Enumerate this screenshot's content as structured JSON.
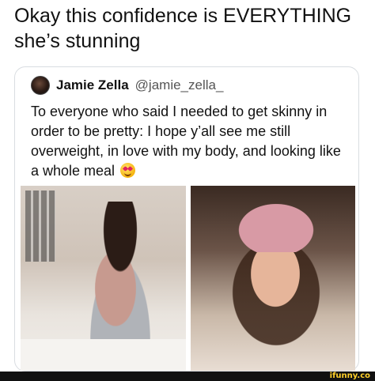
{
  "caption": {
    "line1": "Okay this confidence is EVERYTHING",
    "line2": "she’s stunning"
  },
  "tweet": {
    "author_name": "Jamie Zella",
    "author_handle": "@jamie_zella_",
    "text": "To everyone who said I needed to get skinny in order to be pretty: I hope y’all see me still overweight, in love with my body, and looking like a whole meal",
    "emoji": "heart-eyes-emoji"
  },
  "photos": [
    {
      "name": "mirror-selfie-photo"
    },
    {
      "name": "pink-bucket-hat-selfie-photo"
    }
  ],
  "watermark": {
    "text": "ifunny.co",
    "color": "#ffd02a"
  }
}
